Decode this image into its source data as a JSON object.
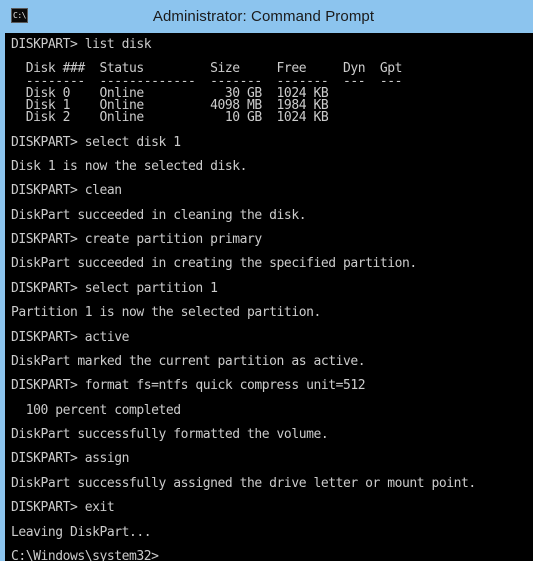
{
  "window": {
    "title": "Administrator: Command Prompt",
    "icon": "command-prompt-icon",
    "icon_glyph": "C:\\",
    "titlebar_color": "#8cc4ee",
    "title_text_color": "#1b1b1b",
    "console_bg": "#000000",
    "console_fg": "#cccccc"
  },
  "console": {
    "lines": [
      "DISKPART> list disk",
      "",
      "  Disk ###  Status         Size     Free     Dyn  Gpt",
      "  --------  -------------  -------  -------  ---  ---",
      "  Disk 0    Online           30 GB  1024 KB",
      "  Disk 1    Online         4098 MB  1984 KB",
      "  Disk 2    Online           10 GB  1024 KB",
      "",
      "DISKPART> select disk 1",
      "",
      "Disk 1 is now the selected disk.",
      "",
      "DISKPART> clean",
      "",
      "DiskPart succeeded in cleaning the disk.",
      "",
      "DISKPART> create partition primary",
      "",
      "DiskPart succeeded in creating the specified partition.",
      "",
      "DISKPART> select partition 1",
      "",
      "Partition 1 is now the selected partition.",
      "",
      "DISKPART> active",
      "",
      "DiskPart marked the current partition as active.",
      "",
      "DISKPART> format fs=ntfs quick compress unit=512",
      "",
      "  100 percent completed",
      "",
      "DiskPart successfully formatted the volume.",
      "",
      "DISKPART> assign",
      "",
      "DiskPart successfully assigned the drive letter or mount point.",
      "",
      "DISKPART> exit",
      "",
      "Leaving DiskPart...",
      "",
      "C:\\Windows\\system32>"
    ],
    "table": {
      "headers": [
        "Disk ###",
        "Status",
        "Size",
        "Free",
        "Dyn",
        "Gpt"
      ],
      "rows": [
        [
          "Disk 0",
          "Online",
          "30 GB",
          "1024 KB",
          "",
          ""
        ],
        [
          "Disk 1",
          "Online",
          "4098 MB",
          "1984 KB",
          "",
          ""
        ],
        [
          "Disk 2",
          "Online",
          "10 GB",
          "1024 KB",
          "",
          ""
        ]
      ]
    },
    "commands": [
      "list disk",
      "select disk 1",
      "clean",
      "create partition primary",
      "select partition 1",
      "active",
      "format fs=ntfs quick compress unit=512",
      "assign",
      "exit"
    ],
    "prompt": "DISKPART>",
    "final_prompt": "C:\\Windows\\system32>"
  }
}
